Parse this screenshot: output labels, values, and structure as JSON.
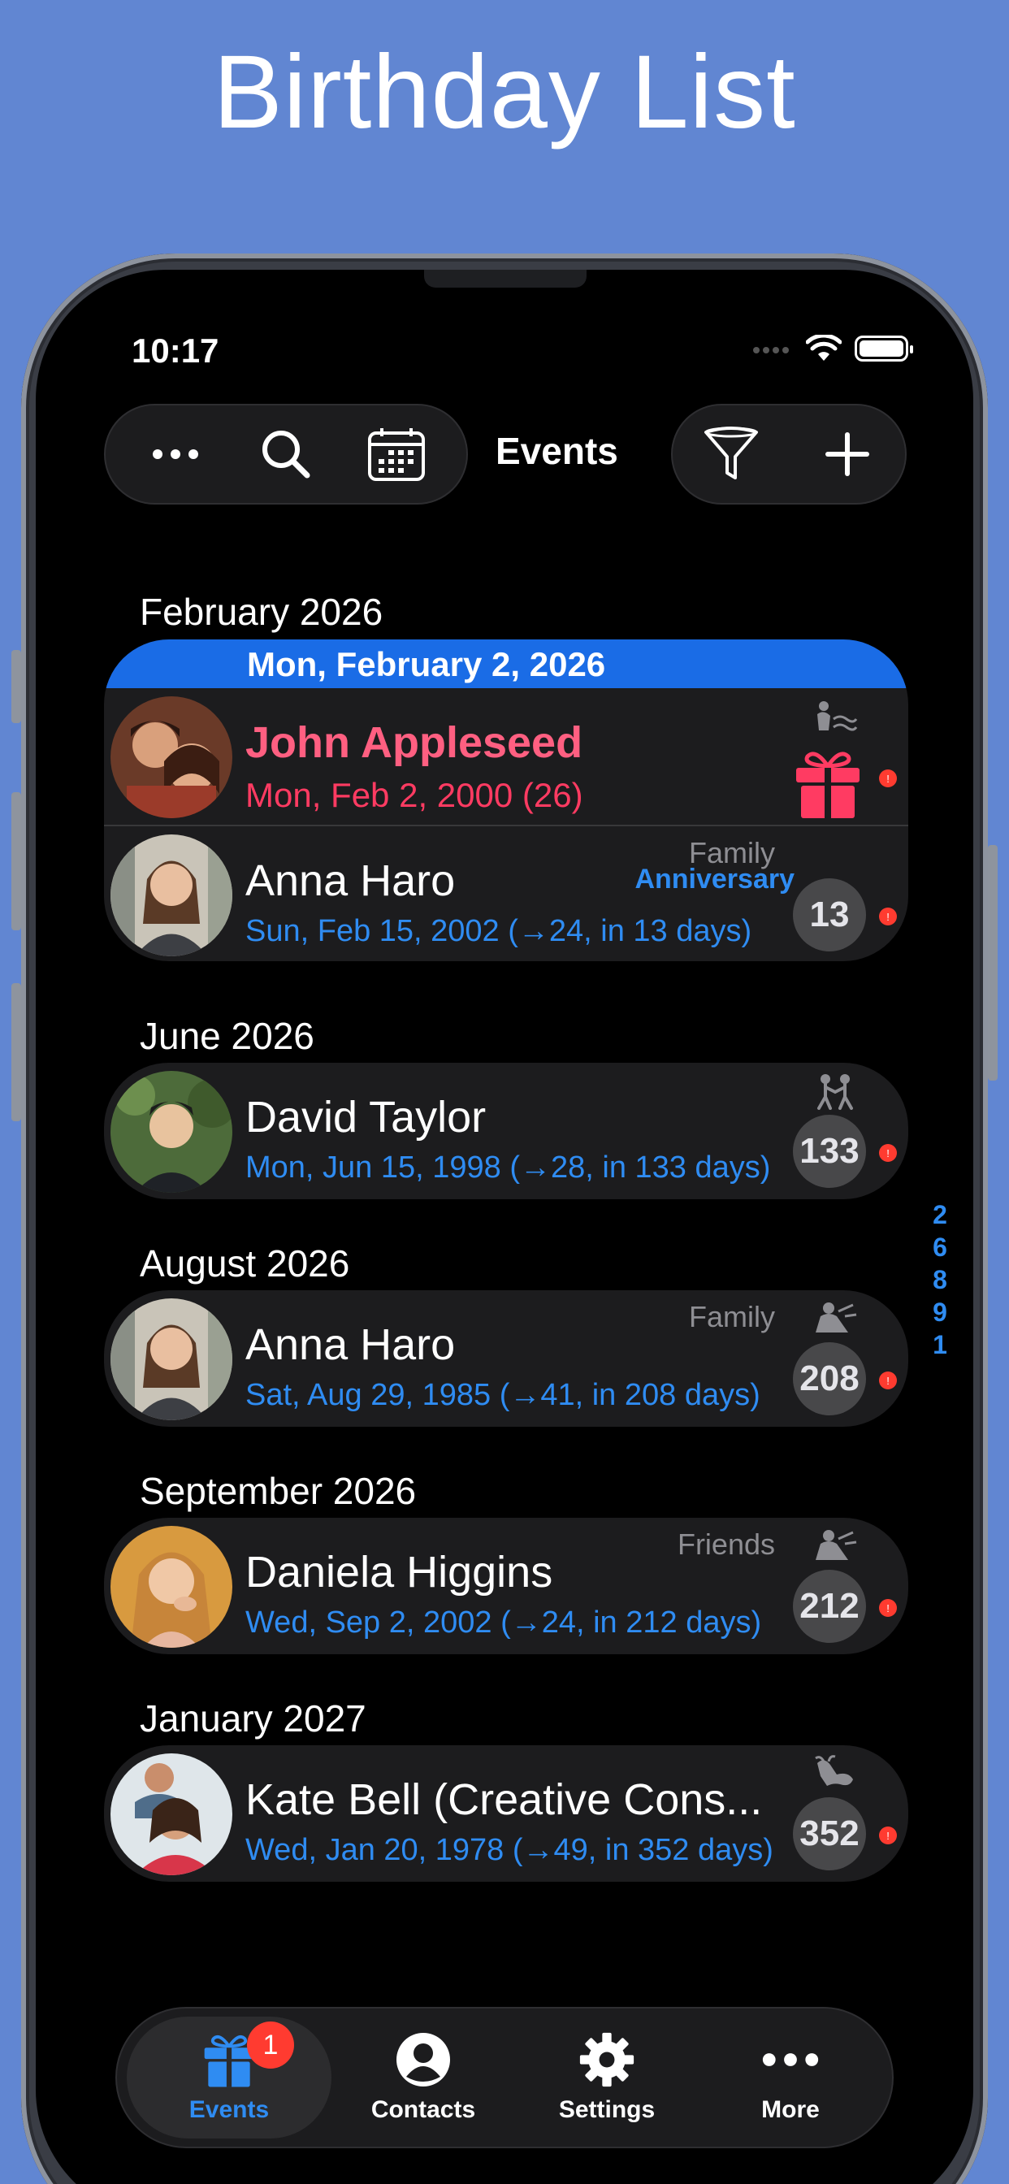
{
  "headline": "Birthday List",
  "status": {
    "time": "10:17"
  },
  "nav": {
    "title": "Events"
  },
  "toolbar": {
    "left_icons": [
      "more-icon",
      "search-icon",
      "calendar-icon"
    ],
    "right_icons": [
      "filter-icon",
      "plus-icon"
    ]
  },
  "sections": [
    {
      "title": "February 2026",
      "day_header": "Mon, February 2, 2026",
      "rows": [
        {
          "name": "John Appleseed",
          "date": "Mon, Feb 2, 2000 (26)",
          "highlight": true,
          "zodiac": "aquarius-icon",
          "badge": ""
        },
        {
          "name": "Anna Haro",
          "date": "Sun, Feb 15, 2002 (→24, in 13 days)",
          "group": "Family",
          "event_type": "Anniversary",
          "days": "13",
          "zodiac": "",
          "badge": ""
        }
      ]
    },
    {
      "title": "June 2026",
      "rows": [
        {
          "name": "David Taylor",
          "date": "Mon, Jun 15, 1998 (→28, in 133 days)",
          "days": "133",
          "zodiac": "gemini-icon",
          "badge": ""
        }
      ]
    },
    {
      "title": "August 2026",
      "rows": [
        {
          "name": "Anna Haro",
          "date": "Sat, Aug 29, 1985 (→41, in 208 days)",
          "group": "Family",
          "days": "208",
          "zodiac": "virgo-icon",
          "badge": ""
        }
      ]
    },
    {
      "title": "September 2026",
      "rows": [
        {
          "name": "Daniela Higgins",
          "date": "Wed, Sep 2, 2002 (→24, in 212 days)",
          "group": "Friends",
          "days": "212",
          "zodiac": "virgo-icon",
          "badge": ""
        }
      ]
    },
    {
      "title": "January 2027",
      "rows": [
        {
          "name": "Kate Bell (Creative Cons...",
          "date": "Wed, Jan 20, 1978 (→49, in 352 days)",
          "days": "352",
          "zodiac": "capricorn-icon",
          "badge": ""
        }
      ]
    }
  ],
  "month_index": [
    "2",
    "6",
    "8",
    "9",
    "1"
  ],
  "tabbar": {
    "tabs": [
      {
        "label": "Events",
        "icon": "gift-icon",
        "active": true,
        "badge": "1"
      },
      {
        "label": "Contacts",
        "icon": "person-icon"
      },
      {
        "label": "Settings",
        "icon": "gear-icon"
      },
      {
        "label": "More",
        "icon": "more-icon"
      }
    ]
  },
  "colors": {
    "background": "#6186d2",
    "accent": "#2f8cf2",
    "highlight": "#ff5f81",
    "day_header": "#1a6ce6"
  }
}
